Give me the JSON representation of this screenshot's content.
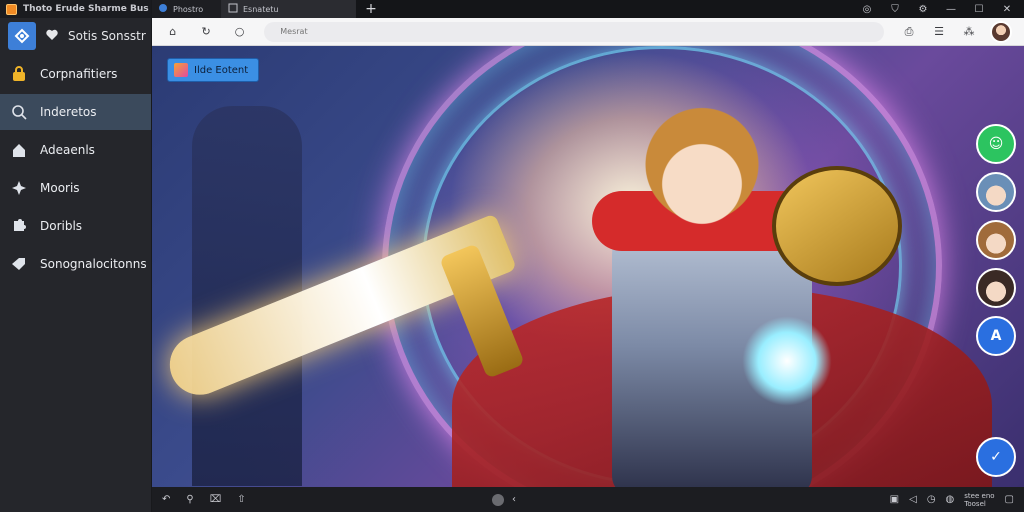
{
  "window": {
    "title": "Thoto Erude Sharme Bus"
  },
  "tabs": [
    {
      "label": "Phostro",
      "active": false
    },
    {
      "label": "Esnatetu",
      "active": true
    }
  ],
  "address_bar": {
    "placeholder": "Mesrat"
  },
  "sidebar": {
    "brand": "Sotis Sonsstr",
    "items": [
      {
        "label": "Corpnafitiers",
        "icon": "lock-icon",
        "active": false
      },
      {
        "label": "Inderetos",
        "icon": "search-icon",
        "active": true
      },
      {
        "label": "Adeaenls",
        "icon": "home-icon",
        "active": false
      },
      {
        "label": "Mooris",
        "icon": "sparkle-icon",
        "active": false
      },
      {
        "label": "Doribls",
        "icon": "puzzle-icon",
        "active": false
      },
      {
        "label": "Sonognalocitonns",
        "icon": "tag-icon",
        "active": false
      }
    ]
  },
  "content": {
    "overlay_button": "Ilde Eotent"
  },
  "statusbar": {
    "right_text_top": "stee eno",
    "right_text_bottom": "Toosel"
  },
  "colors": {
    "accent": "#3b8fe4",
    "sidebar_bg": "#25262b",
    "sidebar_active": "#3b4a5c",
    "green_button": "#2cc460",
    "blue_button": "#2a6fe0"
  }
}
